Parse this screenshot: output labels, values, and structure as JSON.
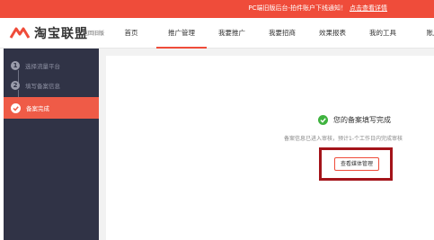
{
  "topbar": {
    "notice": "PC端旧版后台-拍件账户下线通知！",
    "notice_link": "点击查看详情"
  },
  "header": {
    "logo_text": "淘宝联盟",
    "logo_sub": "返回旧版",
    "nav": [
      "首页",
      "推广管理",
      "我要推广",
      "我要招商",
      "效果报表",
      "我的工具",
      "账户"
    ]
  },
  "sidebar": {
    "steps": [
      {
        "num": "1",
        "label": "选择流量平台"
      },
      {
        "num": "2",
        "label": "填写备案信息"
      },
      {
        "num": "",
        "label": "备案完成"
      }
    ]
  },
  "main": {
    "success_title": "您的备案填写完成",
    "success_desc": "备案信息已进入审核，预计1-个工作日内完成审核",
    "button_label": "查看媒体管理"
  },
  "colors": {
    "brand": "#ef4c3a",
    "sidebar": "#303346",
    "success": "#3fb33f",
    "highlight": "#a4141a"
  }
}
